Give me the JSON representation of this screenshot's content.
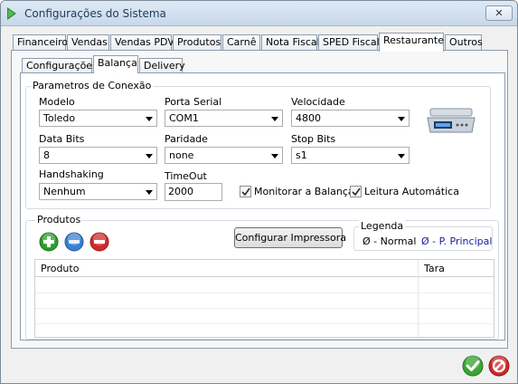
{
  "window": {
    "title": "Configurações do Sistema",
    "close_label": "✕"
  },
  "main_tabs": [
    "Financeiro",
    "Vendas",
    "Vendas PDV",
    "Produtos",
    "Carnê",
    "Nota Fiscal",
    "SPED Fiscal",
    "Restaurante",
    "Outros"
  ],
  "sub_tabs": [
    "Configurações",
    "Balança",
    "Delivery"
  ],
  "conexao": {
    "legend": "Parametros de Conexão",
    "modelo": {
      "label": "Modelo",
      "value": "Toledo"
    },
    "porta": {
      "label": "Porta Serial",
      "value": "COM1"
    },
    "velocidade": {
      "label": "Velocidade",
      "value": "4800"
    },
    "databits": {
      "label": "Data Bits",
      "value": "8"
    },
    "paridade": {
      "label": "Paridade",
      "value": "none"
    },
    "stopbits": {
      "label": "Stop Bits",
      "value": "s1"
    },
    "handshaking": {
      "label": "Handshaking",
      "value": "Nenhum"
    },
    "timeout": {
      "label": "TimeOut",
      "value": "2000"
    },
    "monitorar": {
      "label": "Monitorar a Balança",
      "checked": true
    },
    "leitura": {
      "label": "Leitura Automática",
      "checked": true
    }
  },
  "produtos": {
    "legend": "Produtos",
    "configurar_label": "Configurar Impressora",
    "legenda": {
      "title": "Legenda",
      "normal": "Ø - Normal",
      "principal": "Ø - P. Principal",
      "principal_color": "#1a1aa6"
    },
    "columns": [
      "Produto",
      "Tara"
    ],
    "rows": []
  },
  "colors": {
    "add": "#2e9d2e",
    "edit": "#3b7fd1",
    "remove": "#d22b2b",
    "ok": "#3aa535",
    "cancel": "#cc2b2b"
  },
  "icons": {
    "add": "plus-icon",
    "edit": "edit-icon",
    "remove": "minus-icon",
    "ok": "checkmark-icon",
    "cancel": "cancel-icon"
  }
}
